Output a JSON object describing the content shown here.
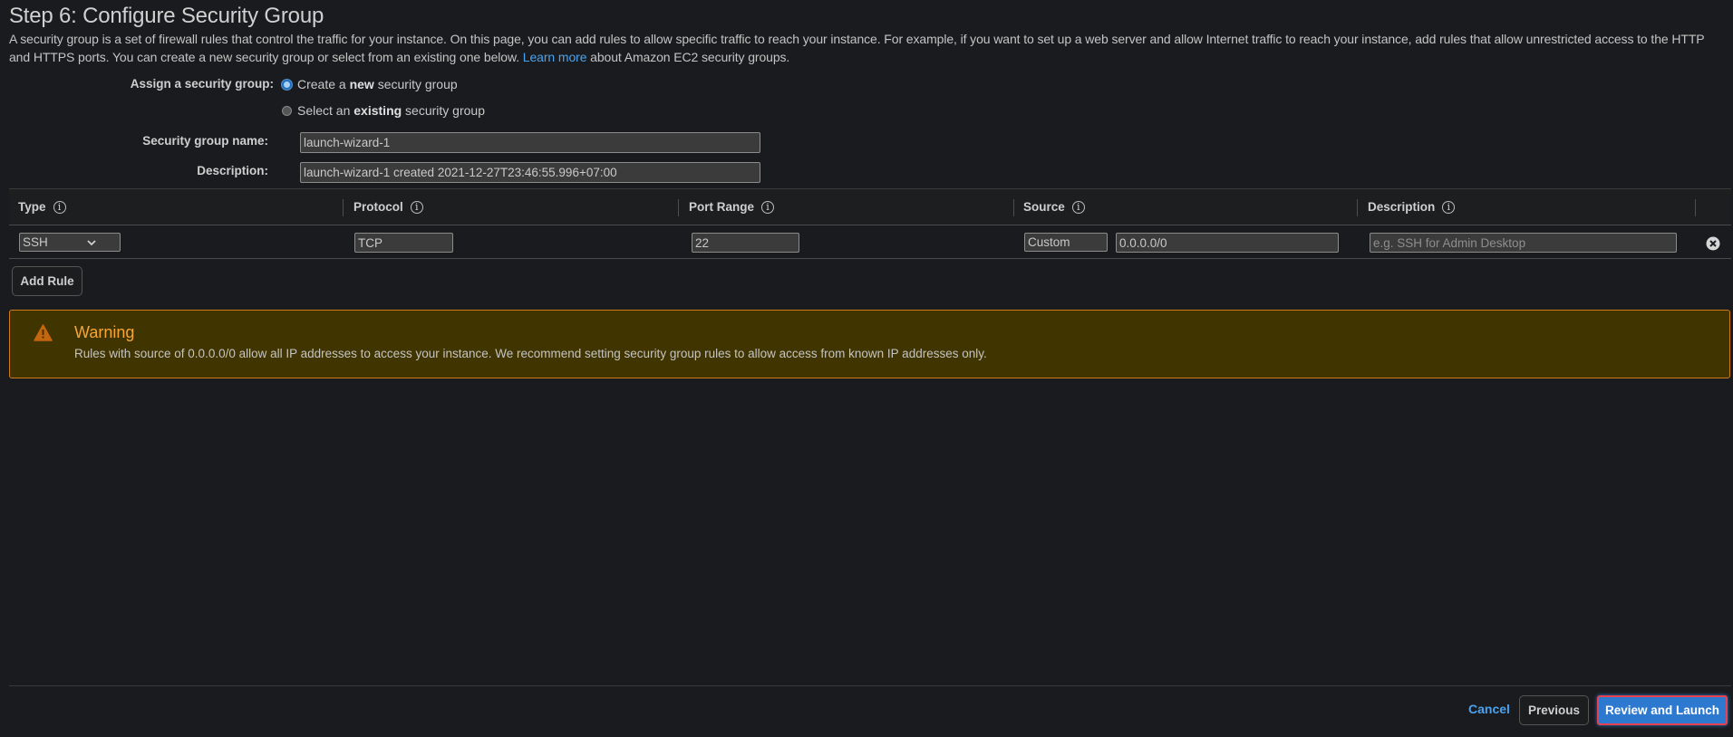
{
  "page": {
    "title": "Step 6: Configure Security Group",
    "intro_text": "A security group is a set of firewall rules that control the traffic for your instance. On this page, you can add rules to allow specific traffic to reach your instance. For example, if you want to set up a web server and allow Internet traffic to reach your instance, add rules that allow unrestricted access to the HTTP and HTTPS ports. You can create a new security group or select from an existing one below.",
    "learn_more": "Learn more",
    "intro_suffix": "about Amazon EC2 security groups."
  },
  "form": {
    "assign_label": "Assign a security group:",
    "radio_new": {
      "pre": "Create a ",
      "bold": "new",
      "post": " security group",
      "checked": true
    },
    "radio_existing": {
      "pre": "Select an ",
      "bold": "existing",
      "post": " security group",
      "checked": false
    },
    "name_label": "Security group name:",
    "name_value": "launch-wizard-1",
    "desc_label": "Description:",
    "desc_value": "launch-wizard-1 created 2021-12-27T23:46:55.996+07:00"
  },
  "table": {
    "headers": [
      "Type",
      "Protocol",
      "Port Range",
      "Source",
      "Description"
    ],
    "info_glyph": "i",
    "rows": [
      {
        "type": "SSH",
        "protocol": "TCP",
        "port_range": "22",
        "source_type": "Custom",
        "source_cidr": "0.0.0.0/0",
        "description_placeholder": "e.g. SSH for Admin Desktop",
        "remove_icon": "close-circle-icon"
      }
    ],
    "add_rule": "Add Rule"
  },
  "warning": {
    "title": "Warning",
    "text": "Rules with source of 0.0.0.0/0 allow all IP addresses to access your instance. We recommend setting security group rules to allow access from known IP addresses only.",
    "icon": "warning-triangle-icon"
  },
  "footer": {
    "cancel": "Cancel",
    "previous": "Previous",
    "review_launch": "Review and Launch"
  },
  "colors": {
    "accent": "#2d79cf",
    "link": "#4aa3f0",
    "warning_border": "#d27a17",
    "warning_bg": "#403400",
    "highlight": "#e8414f"
  }
}
